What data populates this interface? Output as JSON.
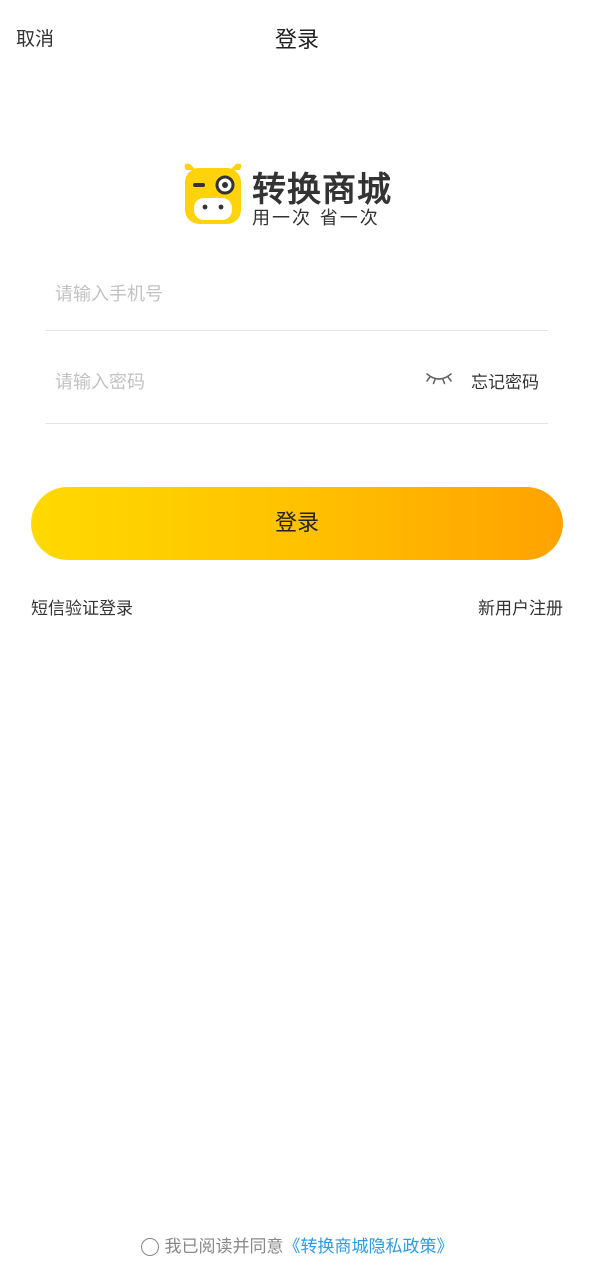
{
  "header": {
    "cancel_label": "取消",
    "title": "登录"
  },
  "logo": {
    "brand_name": "转换商城",
    "slogan": "用一次  省一次",
    "mascot_color": "#ffd30a"
  },
  "form": {
    "phone_placeholder": "请输入手机号",
    "phone_value": "",
    "password_placeholder": "请输入密码",
    "password_value": "",
    "password_visibility_icon": "eye-closed-icon",
    "forgot_password_label": "忘记密码"
  },
  "actions": {
    "login_label": "登录",
    "sms_login_label": "短信验证登录",
    "register_label": "新用户注册"
  },
  "agreement": {
    "text": "我已阅读并同意",
    "policy_link": "《转换商城隐私政策》",
    "checked": false
  },
  "colors": {
    "button_gradient_start": "#ffd900",
    "button_gradient_end": "#ffa200",
    "link": "#2f9be0",
    "placeholder": "#c2c2c2",
    "divider": "#e4e4e4"
  }
}
